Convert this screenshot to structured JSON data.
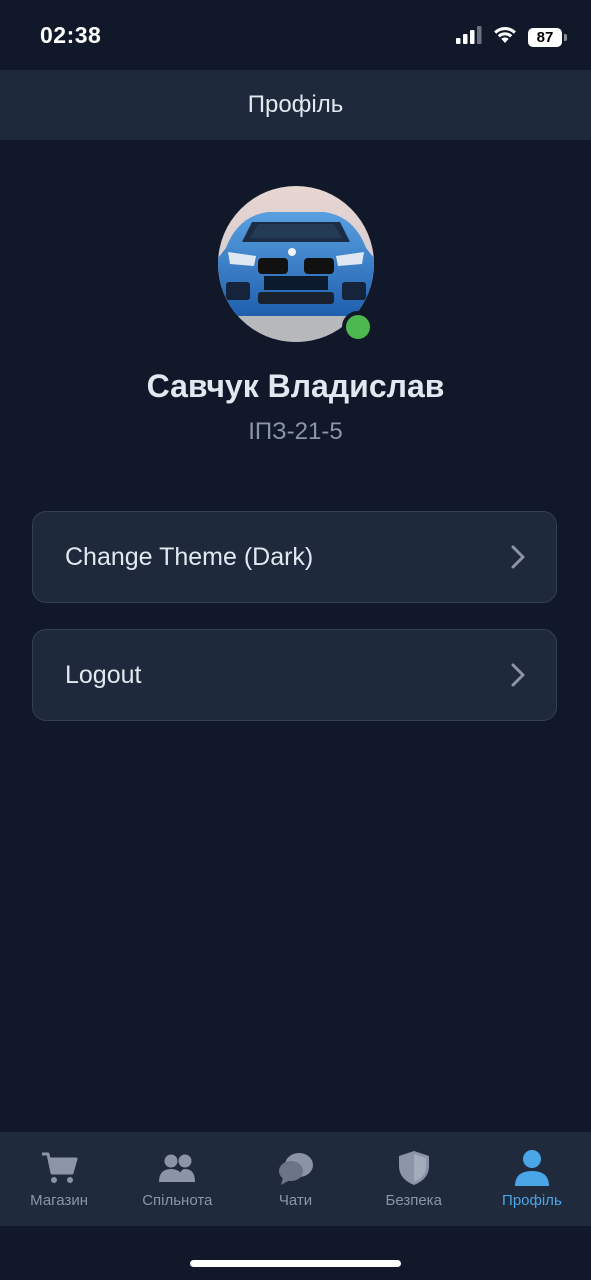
{
  "status_bar": {
    "time": "02:38",
    "battery": "87"
  },
  "header": {
    "title": "Профіль"
  },
  "profile": {
    "name": "Савчук Владислав",
    "group": "ІПЗ-21-5",
    "online": true,
    "online_color": "#4cb84e"
  },
  "menu": {
    "items": [
      {
        "label": "Change Theme (Dark)",
        "icon": "chevron-right-icon"
      },
      {
        "label": "Logout",
        "icon": "chevron-right-icon"
      }
    ]
  },
  "tabbar": {
    "active_color": "#4aa6e6",
    "inactive_color": "#8b95a7",
    "tabs": [
      {
        "label": "Магазин",
        "icon": "cart-icon",
        "active": false
      },
      {
        "label": "Спільнота",
        "icon": "users-icon",
        "active": false
      },
      {
        "label": "Чати",
        "icon": "chat-bubbles-icon",
        "active": false
      },
      {
        "label": "Безпека",
        "icon": "shield-icon",
        "active": false
      },
      {
        "label": "Профіль",
        "icon": "user-icon",
        "active": true
      }
    ]
  }
}
